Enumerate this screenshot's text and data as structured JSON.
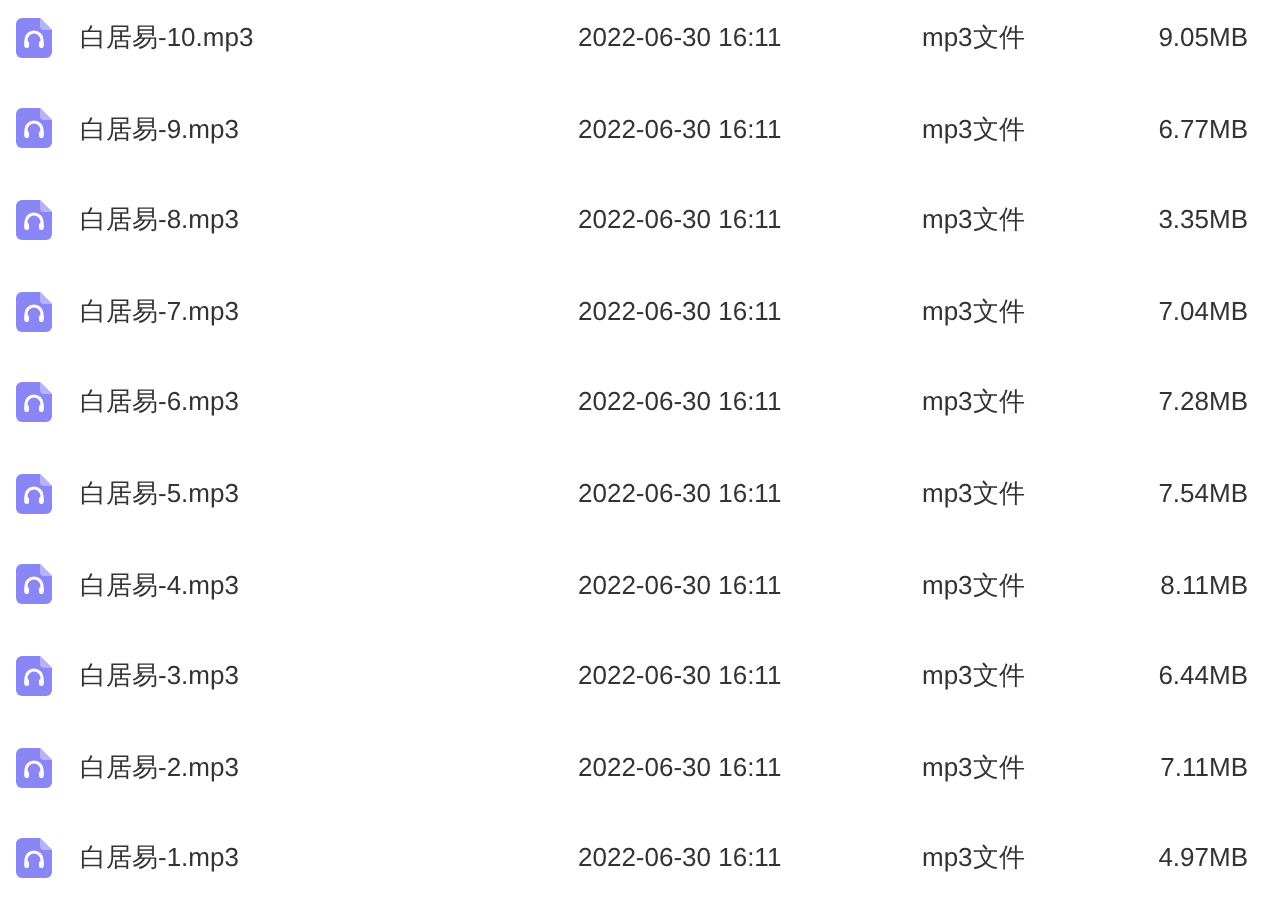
{
  "files": [
    {
      "name": "白居易-10.mp3",
      "modified": "2022-06-30 16:11",
      "type": "mp3文件",
      "size": "9.05MB"
    },
    {
      "name": "白居易-9.mp3",
      "modified": "2022-06-30 16:11",
      "type": "mp3文件",
      "size": "6.77MB"
    },
    {
      "name": "白居易-8.mp3",
      "modified": "2022-06-30 16:11",
      "type": "mp3文件",
      "size": "3.35MB"
    },
    {
      "name": "白居易-7.mp3",
      "modified": "2022-06-30 16:11",
      "type": "mp3文件",
      "size": "7.04MB"
    },
    {
      "name": "白居易-6.mp3",
      "modified": "2022-06-30 16:11",
      "type": "mp3文件",
      "size": "7.28MB"
    },
    {
      "name": "白居易-5.mp3",
      "modified": "2022-06-30 16:11",
      "type": "mp3文件",
      "size": "7.54MB"
    },
    {
      "name": "白居易-4.mp3",
      "modified": "2022-06-30 16:11",
      "type": "mp3文件",
      "size": "8.11MB"
    },
    {
      "name": "白居易-3.mp3",
      "modified": "2022-06-30 16:11",
      "type": "mp3文件",
      "size": "6.44MB"
    },
    {
      "name": "白居易-2.mp3",
      "modified": "2022-06-30 16:11",
      "type": "mp3文件",
      "size": "7.11MB"
    },
    {
      "name": "白居易-1.mp3",
      "modified": "2022-06-30 16:11",
      "type": "mp3文件",
      "size": "4.97MB"
    }
  ]
}
